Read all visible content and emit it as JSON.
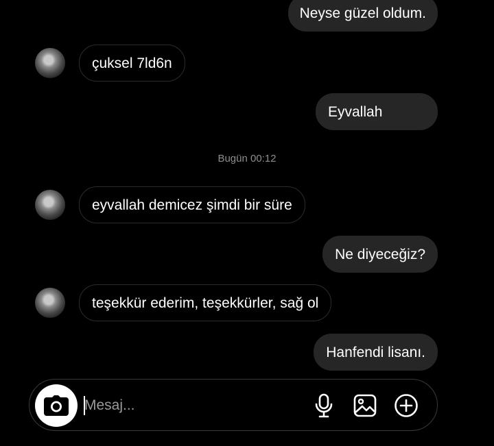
{
  "conversation": {
    "messages": [
      {
        "direction": "out",
        "text": "Neyse güzel oldum."
      },
      {
        "direction": "in",
        "text": "çuksel 7ld6n"
      },
      {
        "direction": "out",
        "text": "Eyvallah"
      },
      {
        "direction": "in",
        "text": "eyvallah demicez şimdi bir süre"
      },
      {
        "direction": "out",
        "text": "Ne diyeceğiz?"
      },
      {
        "direction": "in",
        "text": "teşekkür ederim, teşekkürler, sağ ol"
      },
      {
        "direction": "out",
        "text": "Hanfendi lisanı."
      }
    ],
    "timestamp": "Bugün 00:12"
  },
  "composer": {
    "placeholder": "Mesaj...",
    "icons": [
      "camera-icon",
      "microphone-icon",
      "gallery-icon",
      "add-icon"
    ]
  },
  "colors": {
    "background": "#000000",
    "outgoing_bubble": "#262626",
    "incoming_border": "#2c2c2c",
    "timestamp_text": "#8e8e8e"
  }
}
